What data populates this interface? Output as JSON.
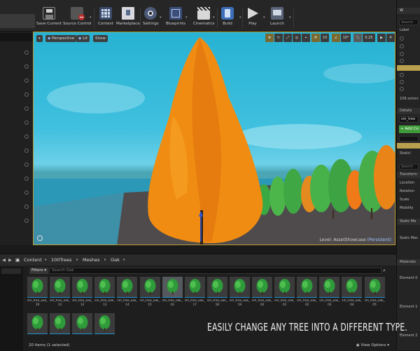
{
  "toolbar": {
    "buttons": [
      {
        "label": "Save Current",
        "icon": "save-icon"
      },
      {
        "label": "Source Control",
        "icon": "source-control-icon"
      },
      {
        "label": "Content",
        "icon": "content-icon"
      },
      {
        "label": "Marketplace",
        "icon": "marketplace-icon"
      },
      {
        "label": "Settings",
        "icon": "gear-icon"
      },
      {
        "label": "Blueprints",
        "icon": "blueprint-icon"
      },
      {
        "label": "Cinematics",
        "icon": "clapper-icon"
      },
      {
        "label": "Build",
        "icon": "build-icon"
      },
      {
        "label": "Play",
        "icon": "play-icon"
      },
      {
        "label": "Launch",
        "icon": "launch-icon"
      }
    ]
  },
  "viewport": {
    "perspective_label": "Perspective",
    "lit_label": "Lit",
    "show_label": "Show",
    "snap_grid": "10",
    "snap_rotation": "10°",
    "snap_scale": "0.25",
    "camera_speed": "4",
    "level_prefix": "Level: ",
    "level_name": "AssetShowcase",
    "level_suffix": " (Persistent)"
  },
  "world_outliner": {
    "search_placeholder": "Search",
    "column_label": "Label",
    "actor_count": "108 actors"
  },
  "details": {
    "tab_label": "Details",
    "selected_name": "sm_tree",
    "add_button": "+ Add Co",
    "search_placeholder": "Search",
    "static_label": "Staticl",
    "transform_section": "Transform",
    "location_label": "Location",
    "rotation_label": "Rotation",
    "scale_label": "Scale",
    "mobility_label": "Mobility",
    "static_mesh_section": "Static Me",
    "static_mesh_label": "Static Mes",
    "materials_section": "Materials",
    "element0": "Element 0",
    "element1": "Element 1",
    "element2": "Element 2"
  },
  "content_browser": {
    "path": [
      "Content",
      "100Trees",
      "Meshes",
      "Oak"
    ],
    "filters_label": "Filters",
    "search_placeholder": "Search Oak",
    "row1": [
      {
        "name": "sm_tree_oak_",
        "num": "10"
      },
      {
        "name": "sm_tree_oak_",
        "num": "11"
      },
      {
        "name": "sm_tree_oak_",
        "num": "12"
      },
      {
        "name": "sm_tree_oak_",
        "num": "13"
      },
      {
        "name": "sm_tree_oak_",
        "num": "14"
      },
      {
        "name": "sm_tree_oak_",
        "num": "15"
      },
      {
        "name": "sm_tree_oak_",
        "num": "16",
        "selected": true
      },
      {
        "name": "sm_tree_oak_",
        "num": "17"
      },
      {
        "name": "sm_tree_oak_",
        "num": "18"
      },
      {
        "name": "sm_tree_oak_",
        "num": "19"
      },
      {
        "name": "sm_tree_oak_",
        "num": "20"
      },
      {
        "name": "sm_tree_oak_",
        "num": "01"
      },
      {
        "name": "sm_tree_oak_",
        "num": "02"
      },
      {
        "name": "sm_tree_oak_",
        "num": "03"
      },
      {
        "name": "sm_tree_oak_",
        "num": "04"
      },
      {
        "name": "sm_tree_oak_",
        "num": "05"
      }
    ],
    "row2_count": 4,
    "caption": "EASILY CHANGE ANY TREE INTO A DIFFERENT TYPE.",
    "item_count": "20 items (1 selected)",
    "view_options": "View Options"
  },
  "colors": {
    "sky": "#2fb6d6",
    "tree_orange": "#f08c12",
    "selection_border": "#b99a33",
    "accent_green": "#3f9b3a"
  }
}
